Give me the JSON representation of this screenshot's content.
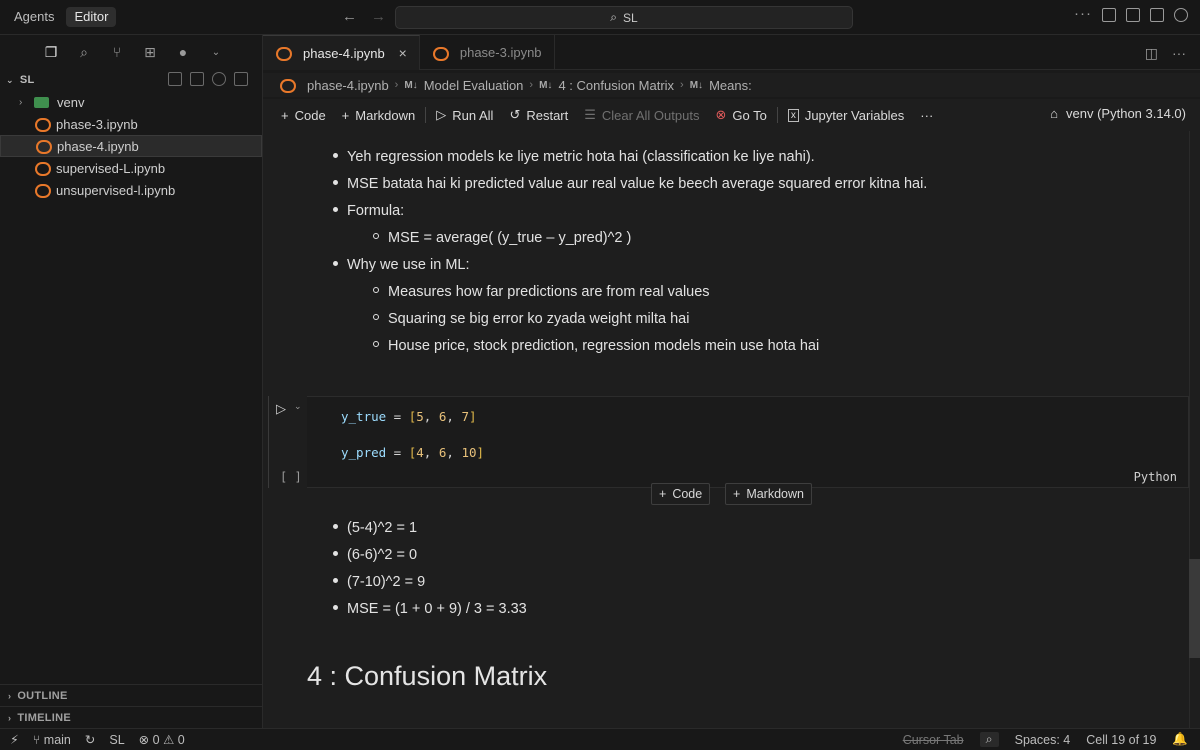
{
  "titlebar": {
    "modes": [
      "Agents",
      "Editor"
    ],
    "search": "SL"
  },
  "sidebar": {
    "folder": "SL",
    "items": [
      {
        "label": "venv",
        "type": "folder"
      },
      {
        "label": "phase-3.ipynb",
        "type": "notebook"
      },
      {
        "label": "phase-4.ipynb",
        "type": "notebook",
        "selected": true
      },
      {
        "label": "supervised-L.ipynb",
        "type": "notebook"
      },
      {
        "label": "unsupervised-l.ipynb",
        "type": "notebook"
      }
    ],
    "outline": "OUTLINE",
    "timeline": "TIMELINE"
  },
  "tabs": [
    {
      "label": "phase-4.ipynb",
      "active": true
    },
    {
      "label": "phase-3.ipynb",
      "active": false
    }
  ],
  "breadcrumb": [
    "phase-4.ipynb",
    "Model Evaluation",
    "4 : Confusion Matrix",
    "Means:"
  ],
  "breadcrumb_md_tag": "M↓",
  "toolbar": {
    "code": "Code",
    "markdown": "Markdown",
    "run_all": "Run All",
    "restart": "Restart",
    "clear_outputs": "Clear All Outputs",
    "go_to": "Go To",
    "jupyter_variables": "Jupyter Variables",
    "kernel": "venv (Python 3.14.0)"
  },
  "markdown1": {
    "b1": "Yeh regression models ke liye metric hota hai (classification ke liye nahi).",
    "b2": "MSE batata hai ki predicted value aur real value ke beech average squared error kitna hai.",
    "b3": "Formula:",
    "b3a": "MSE = average( (y_true – y_pred)^2 )",
    "b4": "Why we use in ML:",
    "b4a": "Measures how far predictions are from real values",
    "b4b": "Squaring se big error ko zyada weight milta hai",
    "b4c": "House price, stock prediction, regression models mein use hota hai"
  },
  "code_cell": {
    "line1_var": "y_true",
    "line1_vals": [
      "5",
      "6",
      "7"
    ],
    "line2_var": "y_pred",
    "line2_vals": [
      "4",
      "6",
      "10"
    ],
    "exec": "[ ]",
    "language": "Python"
  },
  "add_cell": {
    "code": "Code",
    "markdown": "Markdown"
  },
  "markdown2": {
    "b1": "(5-4)^2 = 1",
    "b2": "(6-6)^2 = 0",
    "b3": "(7-10)^2 = 9",
    "b4": "MSE = (1 + 0 + 9) / 3 = 3.33"
  },
  "heading": "4 : Confusion Matrix",
  "statusbar": {
    "branch": "main",
    "workspace": "SL",
    "errors": "0",
    "warnings": "0",
    "cursor_tab": "Cursor Tab",
    "spaces": "Spaces: 4",
    "cell": "Cell 19 of 19"
  }
}
